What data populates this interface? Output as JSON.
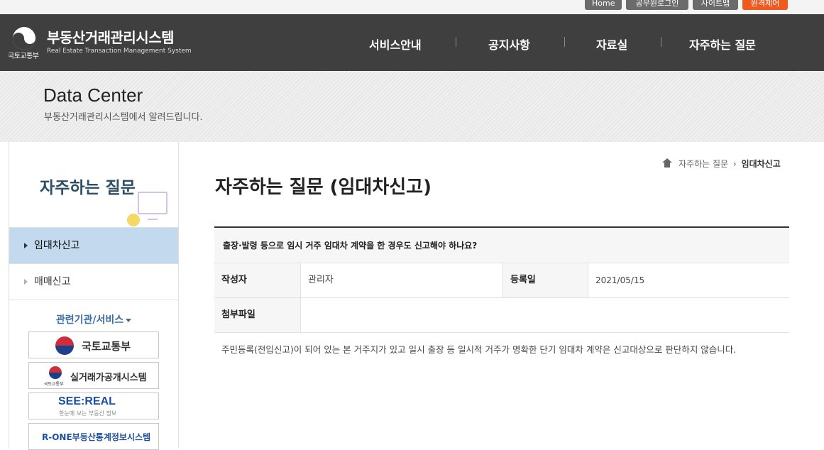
{
  "utility": {
    "buttons": [
      "Home",
      "공무원로그인",
      "사이트맵",
      "원격제어"
    ]
  },
  "header": {
    "title": "부동산거래관리시스템",
    "subtitle": "Real Estate Transaction Management System",
    "ministry": "국토교통부",
    "nav": [
      "서비스안내",
      "공지사항",
      "자료실",
      "자주하는 질문"
    ]
  },
  "banner": {
    "title": "Data Center",
    "subtitle": "부동산거래관리시스템에서 알려드립니다."
  },
  "sidebar": {
    "title": "자주하는 질문",
    "items": [
      {
        "label": "임대차신고",
        "active": true
      },
      {
        "label": "매매신고",
        "active": false
      }
    ],
    "related_title": "관련기관/서비스",
    "agencies": [
      "국토교통부",
      "실거래가공개시스템",
      "SEE:REAL",
      "한눈에 보는 부동산 정보",
      "R-ONE부동산통계정보시스템"
    ],
    "agency_small": "국토교통부"
  },
  "breadcrumb": {
    "section": "자주하는 질문",
    "current": "임대차신고"
  },
  "page": {
    "title": "자주하는 질문 (임대차신고)"
  },
  "post": {
    "question": "출장·발령 등으로 임시 거주 임대차 계약을 한 경우도 신고해야 하나요?",
    "author_label": "작성자",
    "author": "관리자",
    "date_label": "등록일",
    "date": "2021/05/15",
    "attachment_label": "첨부파일",
    "attachment": "",
    "body": "주민등록(전입신고)이 되어 있는 본 거주지가 있고 일시 출장 등 일시적 거주가 명확한 단기 임대차 계약은 신고대상으로 판단하지 않습니다."
  },
  "colors": {
    "header_bg": "#3f3f3f",
    "active_menu_bg": "#c3d9ee",
    "accent_orange": "#ef5a1e",
    "sidebar_title": "#2d4e66"
  }
}
